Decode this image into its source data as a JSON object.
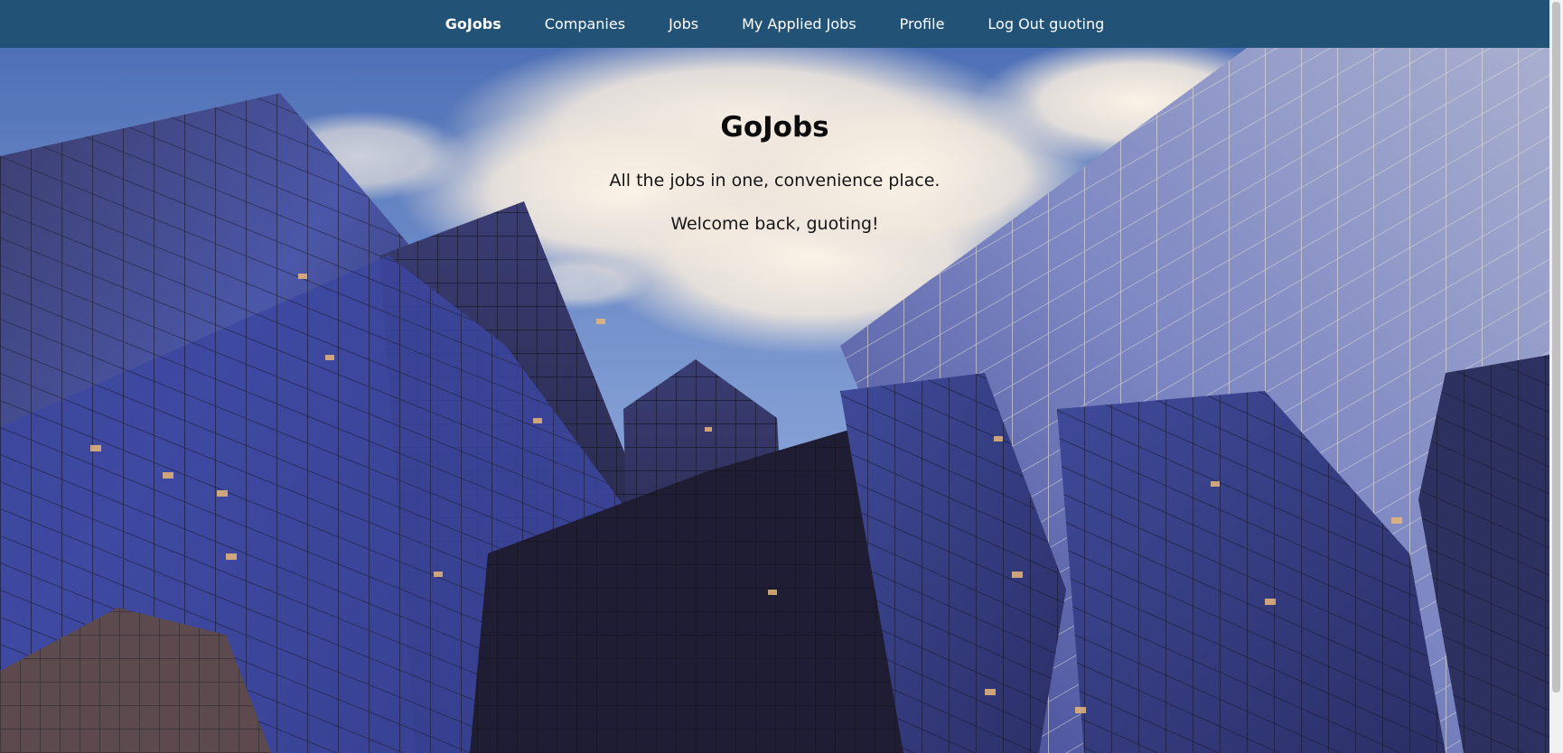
{
  "nav": {
    "brand": "GoJobs",
    "items": [
      {
        "label": "Companies"
      },
      {
        "label": "Jobs"
      },
      {
        "label": "My Applied Jobs"
      },
      {
        "label": "Profile"
      },
      {
        "label": "Log Out guoting"
      }
    ],
    "background_color": "#235277",
    "text_color": "#ffffff"
  },
  "hero": {
    "title": "GoJobs",
    "tagline": "All the jobs in one, convenience place.",
    "welcome": "Welcome back, guoting!",
    "background_image": "glass skyscrapers viewed from below against a cloudy blue sky"
  }
}
